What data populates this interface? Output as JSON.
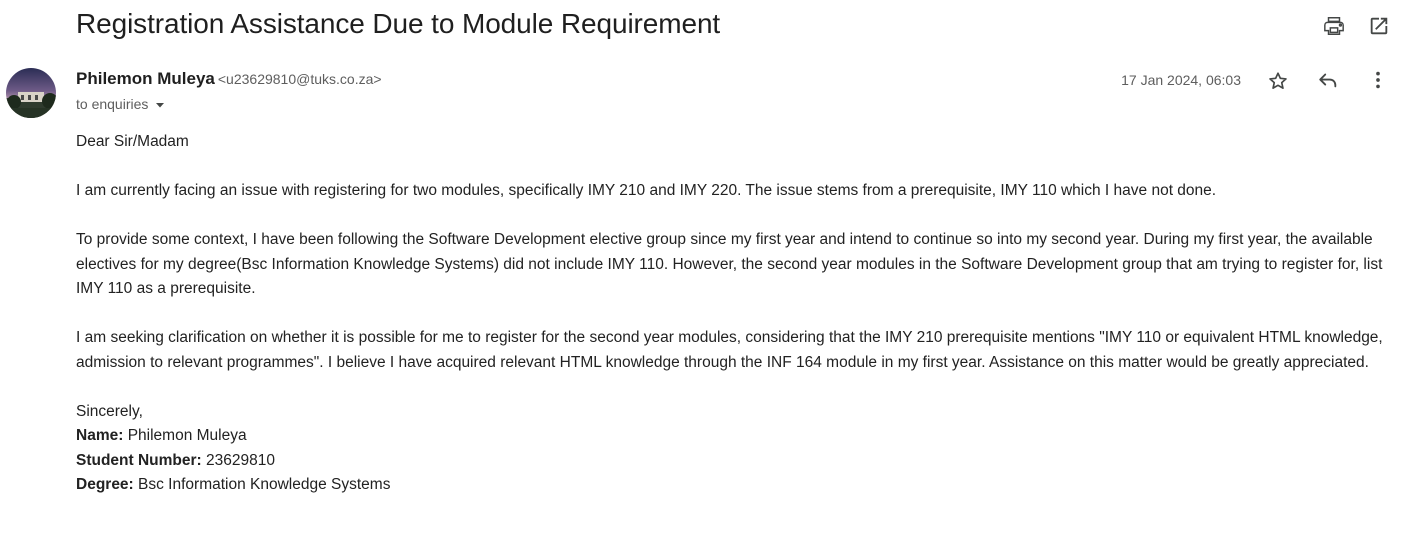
{
  "email": {
    "subject": "Registration Assistance Due to Module Requirement",
    "sender_name": "Philemon Muleya",
    "sender_email": "<u23629810@tuks.co.za>",
    "recipient": "to enquiries",
    "date": "17 Jan 2024, 06:03",
    "greeting": "Dear Sir/Madam",
    "paragraphs": [
      "I am currently facing an issue with registering for two modules, specifically IMY 210 and IMY 220. The issue stems from a prerequisite, IMY 110 which I have not done.",
      "To provide some context, I have been following the Software Development elective group since my first year and intend to continue so into my second year. During my first year, the available electives for my degree(Bsc Information Knowledge Systems) did not include IMY 110. However, the second year modules in the Software Development group that am trying to register for, list IMY 110 as a prerequisite.",
      "I am seeking clarification on whether it is possible for me to register for the second year modules, considering that the IMY 210 prerequisite mentions \"IMY 110 or equivalent HTML knowledge, admission to relevant programmes\". I believe I have acquired relevant HTML knowledge through the INF 164 module in my first year. Assistance on this matter would be greatly appreciated."
    ],
    "closing": "Sincerely,",
    "signature": {
      "name_label": "Name:",
      "name_value": "Philemon Muleya",
      "student_label": "Student Number:",
      "student_value": "23629810",
      "degree_label": "Degree:",
      "degree_value": "Bsc Information Knowledge Systems"
    }
  },
  "icons": {
    "print": "print-icon",
    "open_new_window": "open-in-new-window-icon",
    "star": "star-icon",
    "reply": "reply-icon",
    "more": "more-vertical-icon",
    "recipient_caret": "caret-down-icon"
  },
  "colors": {
    "text_primary": "#1f1f1f",
    "text_secondary": "#5e5e5e",
    "icon": "#444746"
  }
}
